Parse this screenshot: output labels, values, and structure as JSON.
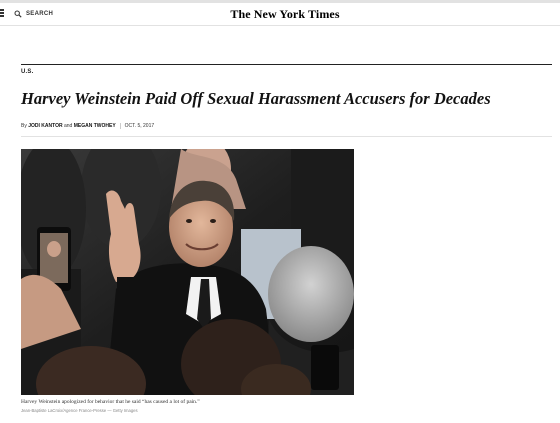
{
  "masthead": {
    "menu_icon": "hamburger-menu-icon",
    "search_icon": "search-icon",
    "search_label": "SEARCH",
    "logo_text": "The New York Times"
  },
  "article": {
    "section": "U.S.",
    "headline": "Harvey Weinstein Paid Off Sexual Harassment Accusers for Decades",
    "byline": {
      "prefix": "By",
      "author1": "JODI KANTOR",
      "conjunction": "and",
      "author2": "MEGAN TWOHEY",
      "date": "OCT. 5, 2017"
    },
    "photo": {
      "caption": "Harvey Weinstein apologized for behavior that he said “has caused a lot of pain.”",
      "credit": "Jean-Baptiste LaCroix/Agence France-Presse — Getty Images"
    }
  },
  "colors": {
    "text": "#121212",
    "rule": "#e2e2e2",
    "muted": "#888888"
  }
}
